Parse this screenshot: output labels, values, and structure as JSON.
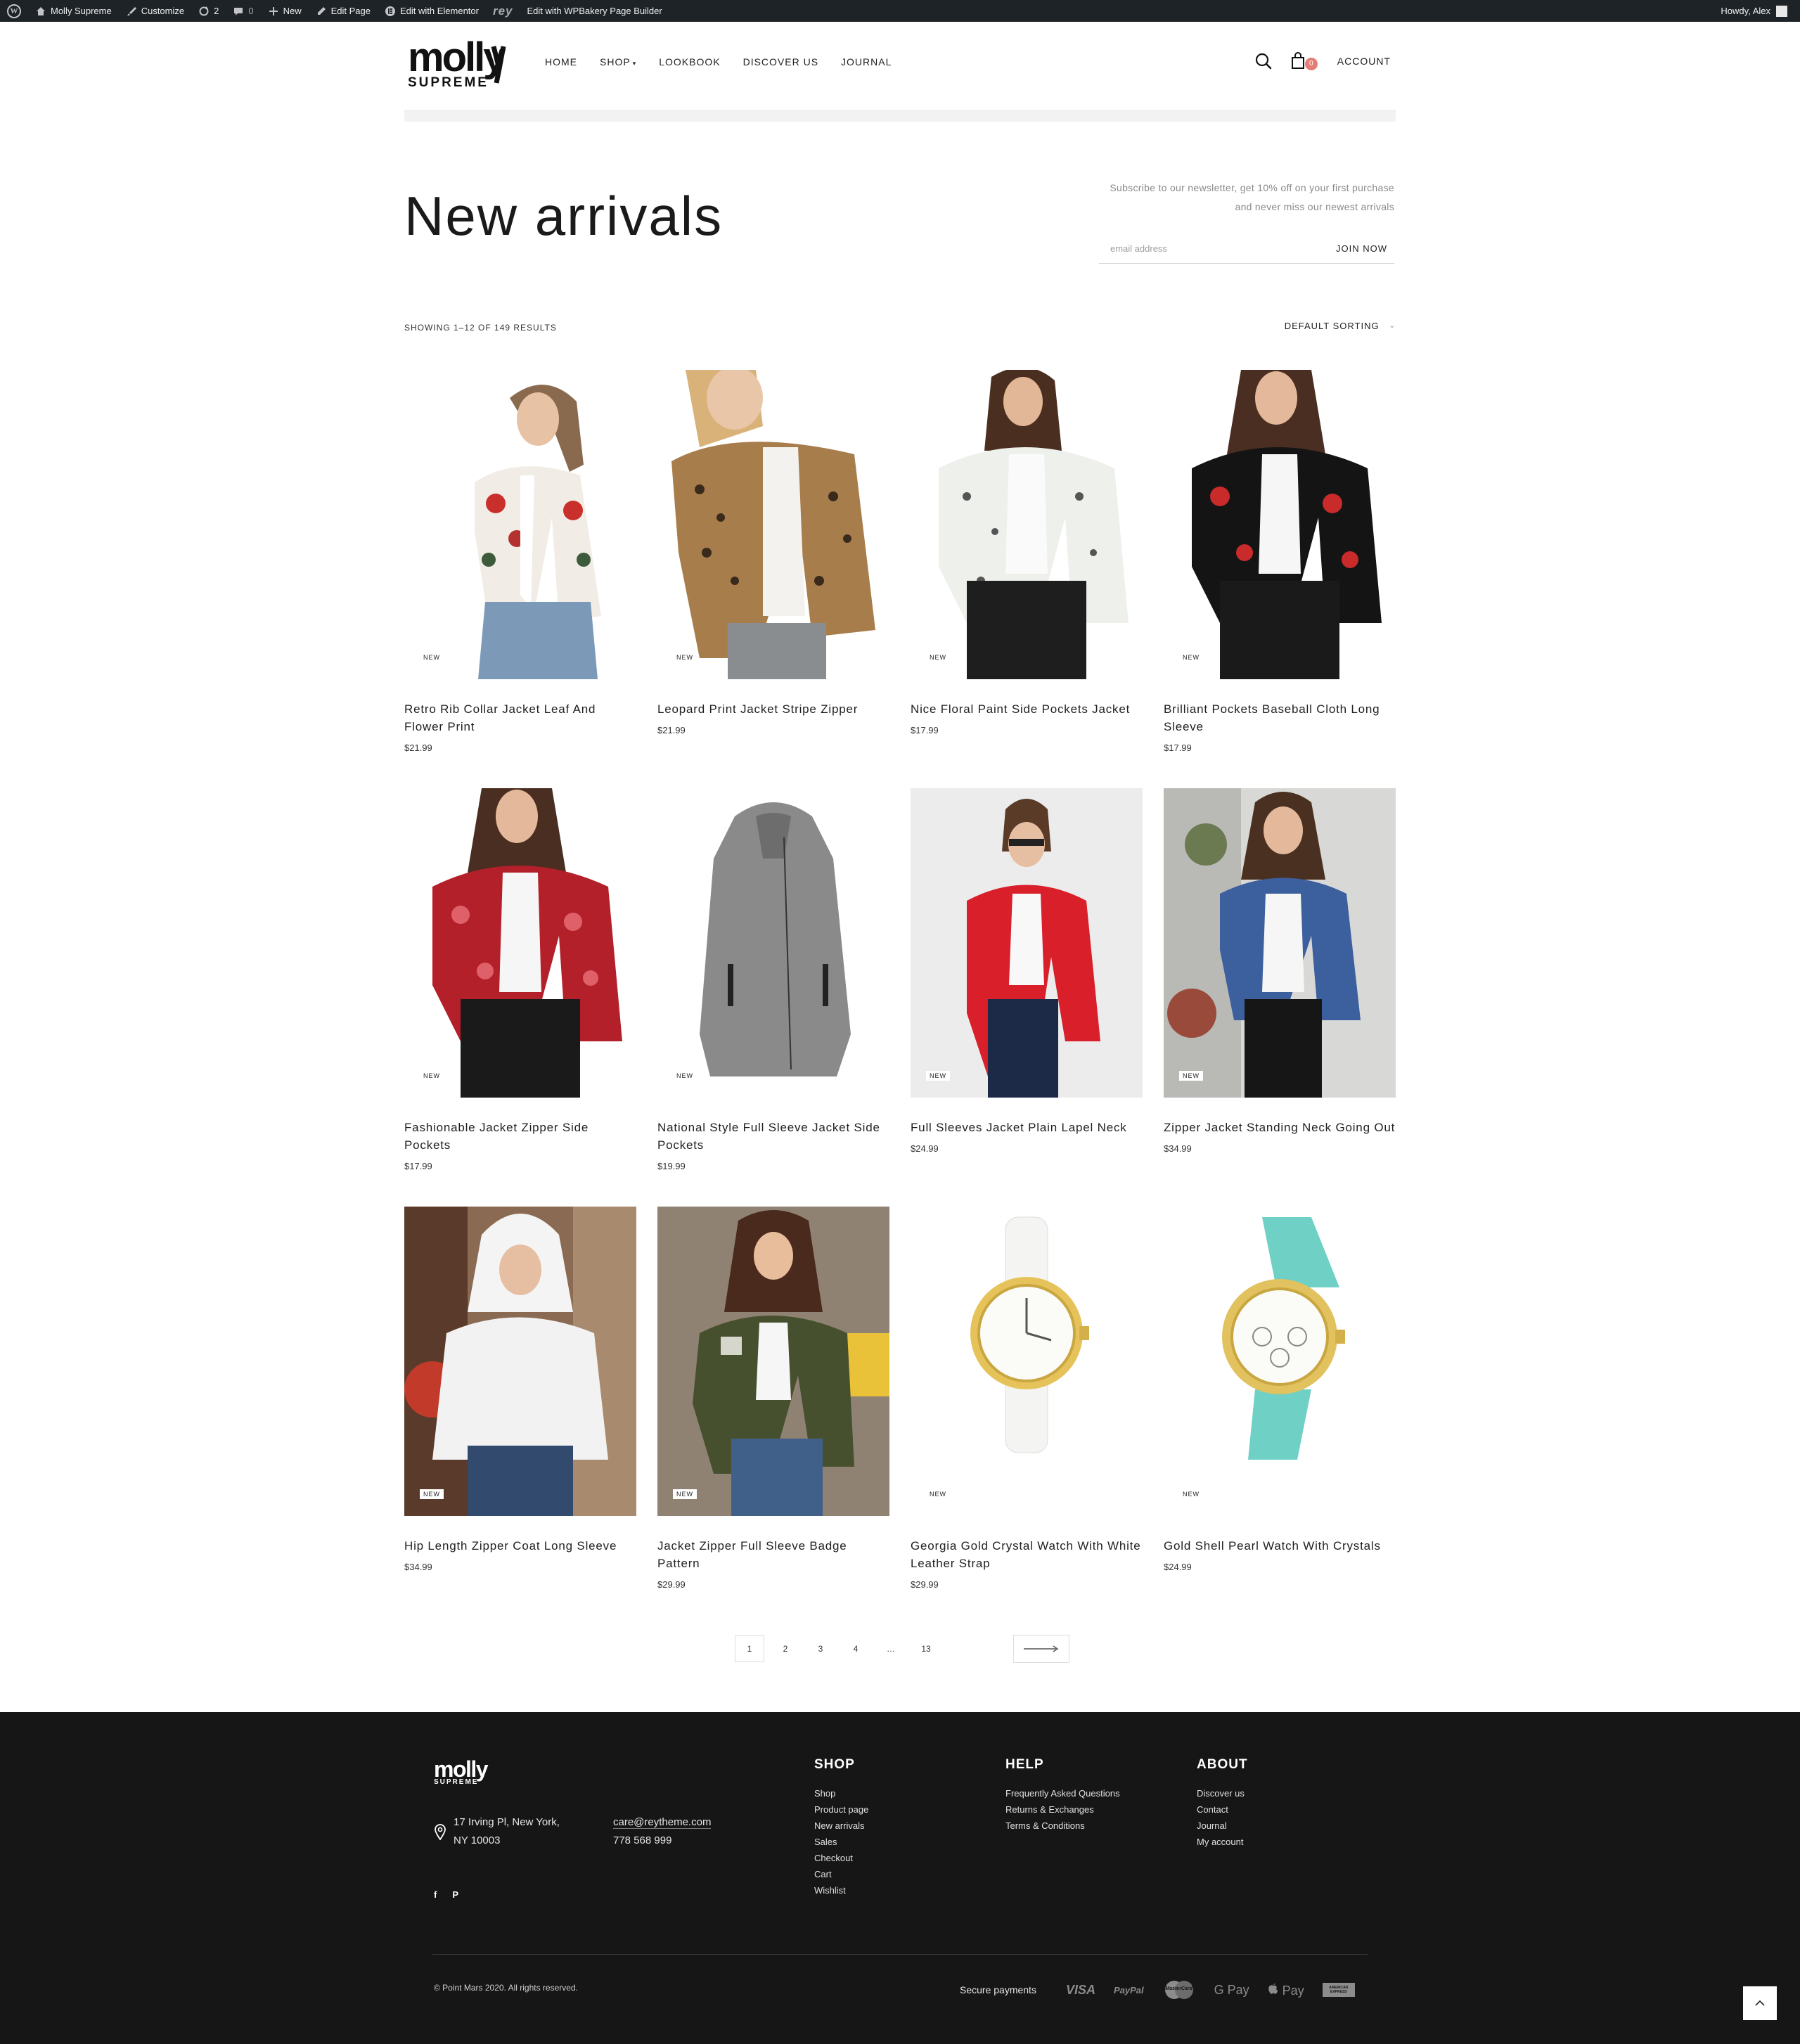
{
  "adminbar": {
    "site": "Molly Supreme",
    "customize": "Customize",
    "updates": "2",
    "comments": "0",
    "new": "New",
    "edit_page": "Edit Page",
    "edit_elementor": "Edit with Elementor",
    "rey": "rey",
    "edit_wpbakery": "Edit with WPBakery Page Builder",
    "howdy": "Howdy, Alex"
  },
  "header": {
    "logo_word": "molly",
    "logo_sub": "SUPREME",
    "nav": [
      "HOME",
      "SHOP",
      "LOOKBOOK",
      "DISCOVER US",
      "JOURNAL"
    ],
    "cart_count": "0",
    "account": "ACCOUNT"
  },
  "page": {
    "title": "New arrivals",
    "newsletter_line1": "Subscribe to our newsletter, get 10% off on your first purchase",
    "newsletter_line2": "and never miss our newest arrivals",
    "email_placeholder": "email address",
    "join": "JOIN NOW",
    "results": "SHOWING 1–12 OF 149 RESULTS",
    "sorting": "DEFAULT SORTING"
  },
  "products": [
    {
      "name": "Retro Rib Collar Jacket Leaf And Flower Print",
      "price": "$21.99",
      "badge": "NEW"
    },
    {
      "name": "Leopard Print Jacket Stripe Zipper",
      "price": "$21.99",
      "badge": "NEW"
    },
    {
      "name": "Nice Floral Paint Side Pockets Jacket",
      "price": "$17.99",
      "badge": "NEW"
    },
    {
      "name": "Brilliant Pockets Baseball Cloth Long Sleeve",
      "price": "$17.99",
      "badge": "NEW"
    },
    {
      "name": "Fashionable Jacket Zipper Side Pockets",
      "price": "$17.99",
      "badge": "NEW"
    },
    {
      "name": "National Style Full Sleeve Jacket Side Pockets",
      "price": "$19.99",
      "badge": "NEW"
    },
    {
      "name": "Full Sleeves Jacket Plain Lapel Neck",
      "price": "$24.99",
      "badge": "NEW"
    },
    {
      "name": "Zipper Jacket Standing Neck Going Out",
      "price": "$34.99",
      "badge": "NEW"
    },
    {
      "name": "Hip Length Zipper Coat Long Sleeve",
      "price": "$34.99",
      "badge": "NEW"
    },
    {
      "name": "Jacket Zipper Full Sleeve Badge Pattern",
      "price": "$29.99",
      "badge": "NEW"
    },
    {
      "name": "Georgia Gold Crystal Watch With White Leather Strap",
      "price": "$29.99",
      "badge": "NEW"
    },
    {
      "name": "Gold Shell Pearl Watch With Crystals",
      "price": "$24.99",
      "badge": "NEW"
    }
  ],
  "pagination": [
    "1",
    "2",
    "3",
    "4",
    "…",
    "13"
  ],
  "footer": {
    "logo_word": "molly",
    "logo_sub": "SUPREME",
    "address_line1": "17 Irving Pl, New York,",
    "address_line2": "NY 10003",
    "email": "care@reytheme.com",
    "phone": "778 568 999",
    "social": [
      "f",
      "P"
    ],
    "shop_title": "SHOP",
    "shop_links": [
      "Shop",
      "Product page",
      "New arrivals",
      "Sales",
      "Checkout",
      "Cart",
      "Wishlist"
    ],
    "help_title": "HELP",
    "help_links": [
      "Frequently Asked Questions",
      "Returns & Exchanges",
      "Terms & Conditions"
    ],
    "about_title": "ABOUT",
    "about_links": [
      "Discover us",
      "Contact",
      "Journal",
      "My account"
    ],
    "copyright": "© Point Mars 2020. All rights reserved.",
    "payments_label": "Secure payments",
    "payments": [
      "VISA",
      "PayPal",
      "MasterCard",
      "G Pay",
      "Pay",
      "AMERICAN EXPRESS"
    ]
  },
  "colors": {
    "accent": "#e57d75",
    "footer_bg": "#161616",
    "adminbar_bg": "#1d2327"
  }
}
